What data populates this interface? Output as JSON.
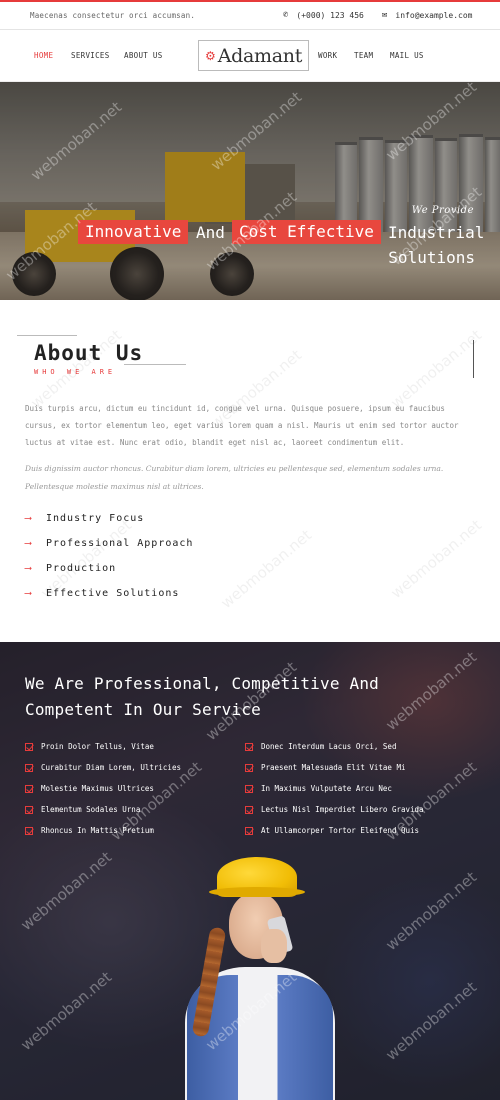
{
  "topbar": {
    "tagline": "Maecenas consectetur orci accumsan.",
    "phone_icon": "phone-icon",
    "phone": "(+000) 123 456",
    "email_icon": "envelope-icon",
    "email": "info@example.com"
  },
  "nav": {
    "left": [
      "HOME",
      "SERVICES",
      "ABOUT US"
    ],
    "right": [
      "WORK",
      "TEAM",
      "MAIL US"
    ],
    "active": "HOME",
    "logo_icon": "gear-icon",
    "logo_text": "Adamant"
  },
  "hero": {
    "kicker": "We Provide",
    "highlight_1": "Innovative",
    "connector": "And",
    "highlight_2": "Cost Effective",
    "tail": "Industrial",
    "line2": "Solutions"
  },
  "about": {
    "title": "About Us",
    "subtitle": "WHO WE ARE",
    "paragraph": "Duis turpis arcu, dictum eu tincidunt id, congue vel urna. Quisque posuere, ipsum eu faucibus cursus, ex tortor elementum leo, eget varius lorem quam a nisl. Mauris ut enim sed tortor auctor luctus at vitae est. Nunc erat odio, blandit eget nisl ac, laoreet condimentum elit.",
    "paragraph_italic": "Duis dignissim auctor rhoncus. Curabitur diam lorem, ultricies eu pellentesque sed, elementum sodales urna. Pellentesque molestie maximus nisl at ultrices.",
    "features": [
      "Industry Focus",
      "Professional Approach",
      "Production",
      "Effective Solutions"
    ]
  },
  "services": {
    "heading": "We Are Professional, Competitive And Competent In Our Service",
    "left_items": [
      "Proin Dolor Tellus, Vitae",
      "Curabitur Diam Lorem, Ultricies",
      "Molestie Maximus Ultrices",
      "Elementum Sodales Urna",
      "Rhoncus In Mattis Pretium"
    ],
    "right_items": [
      "Donec Interdum Lacus Orci, Sed",
      "Praesent Malesuada Elit Vitae Mi",
      "In Maximus Vulputate Arcu Nec",
      "Lectus Nisl Imperdiet Libero Gravida",
      "At Ullamcorper Tortor Eleifend Quis"
    ]
  },
  "watermark": "webmoban.net",
  "colors": {
    "accent": "#e63b3b",
    "helmet": "#f1bd06"
  }
}
